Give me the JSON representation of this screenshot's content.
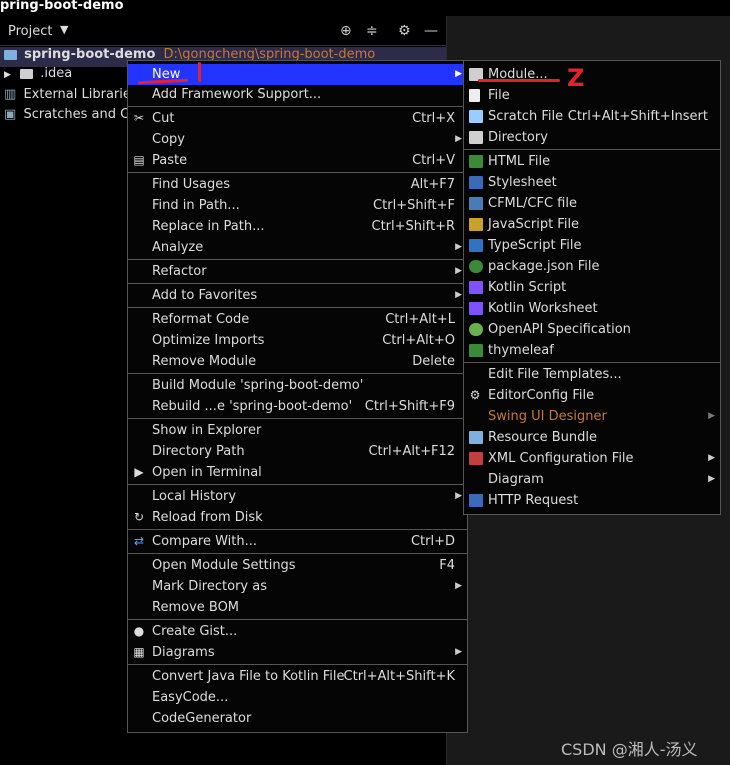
{
  "window": {
    "title": "pring-boot-demo"
  },
  "panel": {
    "title": "Project"
  },
  "tree": {
    "root_label": "spring-boot-demo",
    "root_path": "D:\\gongcheng\\spring-boot-demo",
    "idea": ".idea",
    "ext": "External Libraries",
    "scratch": "Scratches and Cor"
  },
  "menu": {
    "new": "New",
    "add_framework": "Add Framework Support...",
    "cut": "Cut",
    "cut_sc": "Ctrl+X",
    "copy": "Copy",
    "paste": "Paste",
    "paste_sc": "Ctrl+V",
    "find_usages": "Find Usages",
    "find_usages_sc": "Alt+F7",
    "find_in_path": "Find in Path...",
    "find_in_path_sc": "Ctrl+Shift+F",
    "replace_in_path": "Replace in Path...",
    "replace_in_path_sc": "Ctrl+Shift+R",
    "analyze": "Analyze",
    "refactor": "Refactor",
    "add_fav": "Add to Favorites",
    "reformat": "Reformat Code",
    "reformat_sc": "Ctrl+Alt+L",
    "optimize": "Optimize Imports",
    "optimize_sc": "Ctrl+Alt+O",
    "remove_module": "Remove Module",
    "remove_module_sc": "Delete",
    "build_module": "Build Module 'spring-boot-demo'",
    "rebuild": "Rebuild ...e 'spring-boot-demo'",
    "rebuild_sc": "Ctrl+Shift+F9",
    "show_explorer": "Show in Explorer",
    "dir_path": "Directory Path",
    "dir_path_sc": "Ctrl+Alt+F12",
    "open_terminal": "Open in Terminal",
    "local_history": "Local History",
    "reload": "Reload from Disk",
    "compare": "Compare With...",
    "compare_sc": "Ctrl+D",
    "open_module_settings": "Open Module Settings",
    "open_module_settings_sc": "F4",
    "mark_dir": "Mark Directory as",
    "remove_bom": "Remove BOM",
    "create_gist": "Create Gist...",
    "diagrams": "Diagrams",
    "convert_kotlin": "Convert Java File to Kotlin File",
    "convert_kotlin_sc": "Ctrl+Alt+Shift+K",
    "easycode": "EasyCode...",
    "codegen": "CodeGenerator"
  },
  "submenu": {
    "module": "Module...",
    "file": "File",
    "scratch": "Scratch File",
    "scratch_sc": "Ctrl+Alt+Shift+Insert",
    "directory": "Directory",
    "html": "HTML File",
    "stylesheet": "Stylesheet",
    "cfml": "CFML/CFC file",
    "js": "JavaScript File",
    "ts": "TypeScript File",
    "pkg": "package.json File",
    "kotlin": "Kotlin Script",
    "kotlin_ws": "Kotlin Worksheet",
    "openapi": "OpenAPI Specification",
    "thymeleaf": "thymeleaf",
    "edit_templates": "Edit File Templates...",
    "editorconfig": "EditorConfig File",
    "swing": "Swing UI Designer",
    "resource_bundle": "Resource Bundle",
    "xml_config": "XML Configuration File",
    "diagram": "Diagram",
    "http": "HTTP Request"
  },
  "annotations": {
    "one": "",
    "two": "Z"
  },
  "watermark": "CSDN @湘人-汤义",
  "colors": {
    "highlight": "#2434ff",
    "annotation": "#e8202a",
    "disabled": "#c87832"
  }
}
